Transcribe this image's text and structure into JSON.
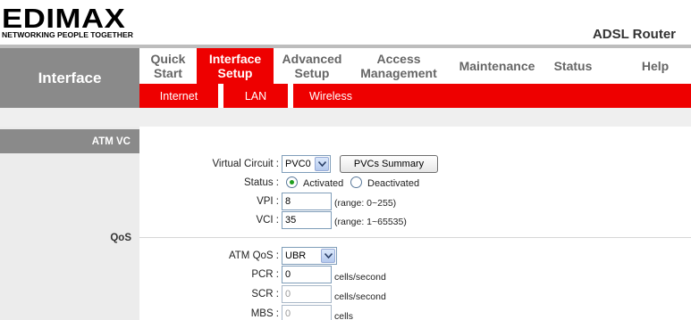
{
  "header": {
    "logo_text": "EDIMAX",
    "logo_tagline": "NETWORKING PEOPLE TOGETHER",
    "product_name": "ADSL Router"
  },
  "left_title": "Interface",
  "nav": [
    {
      "label": "Quick\nStart",
      "active": false
    },
    {
      "label": "Interface\nSetup",
      "active": true
    },
    {
      "label": "Advanced\nSetup",
      "active": false
    },
    {
      "label": "Access\nManagement",
      "active": false
    },
    {
      "label": "Maintenance",
      "active": false
    },
    {
      "label": "Status",
      "active": false
    },
    {
      "label": "Help",
      "active": false
    }
  ],
  "subnav": [
    "Internet",
    "LAN",
    "Wireless"
  ],
  "sections": {
    "atm_vc": "ATM VC",
    "qos": "QoS"
  },
  "form": {
    "virtual_circuit_label": "Virtual Circuit :",
    "virtual_circuit_value": "PVC0",
    "pvcs_summary_button": "PVCs Summary",
    "status_label": "Status :",
    "status_activated": "Activated",
    "status_deactivated": "Deactivated",
    "vpi_label": "VPI :",
    "vpi_value": "8",
    "vpi_hint": "(range: 0~255)",
    "vci_label": "VCI :",
    "vci_value": "35",
    "vci_hint": "(range: 1~65535)",
    "atm_qos_label": "ATM QoS :",
    "atm_qos_value": "UBR",
    "pcr_label": "PCR :",
    "pcr_value": "0",
    "pcr_unit": "cells/second",
    "scr_label": "SCR :",
    "scr_value": "0",
    "scr_unit": "cells/second",
    "mbs_label": "MBS :",
    "mbs_value": "0",
    "mbs_unit": "cells"
  },
  "colors": {
    "accent_red": "#ee0000",
    "header_gray": "#8a8a8a"
  }
}
